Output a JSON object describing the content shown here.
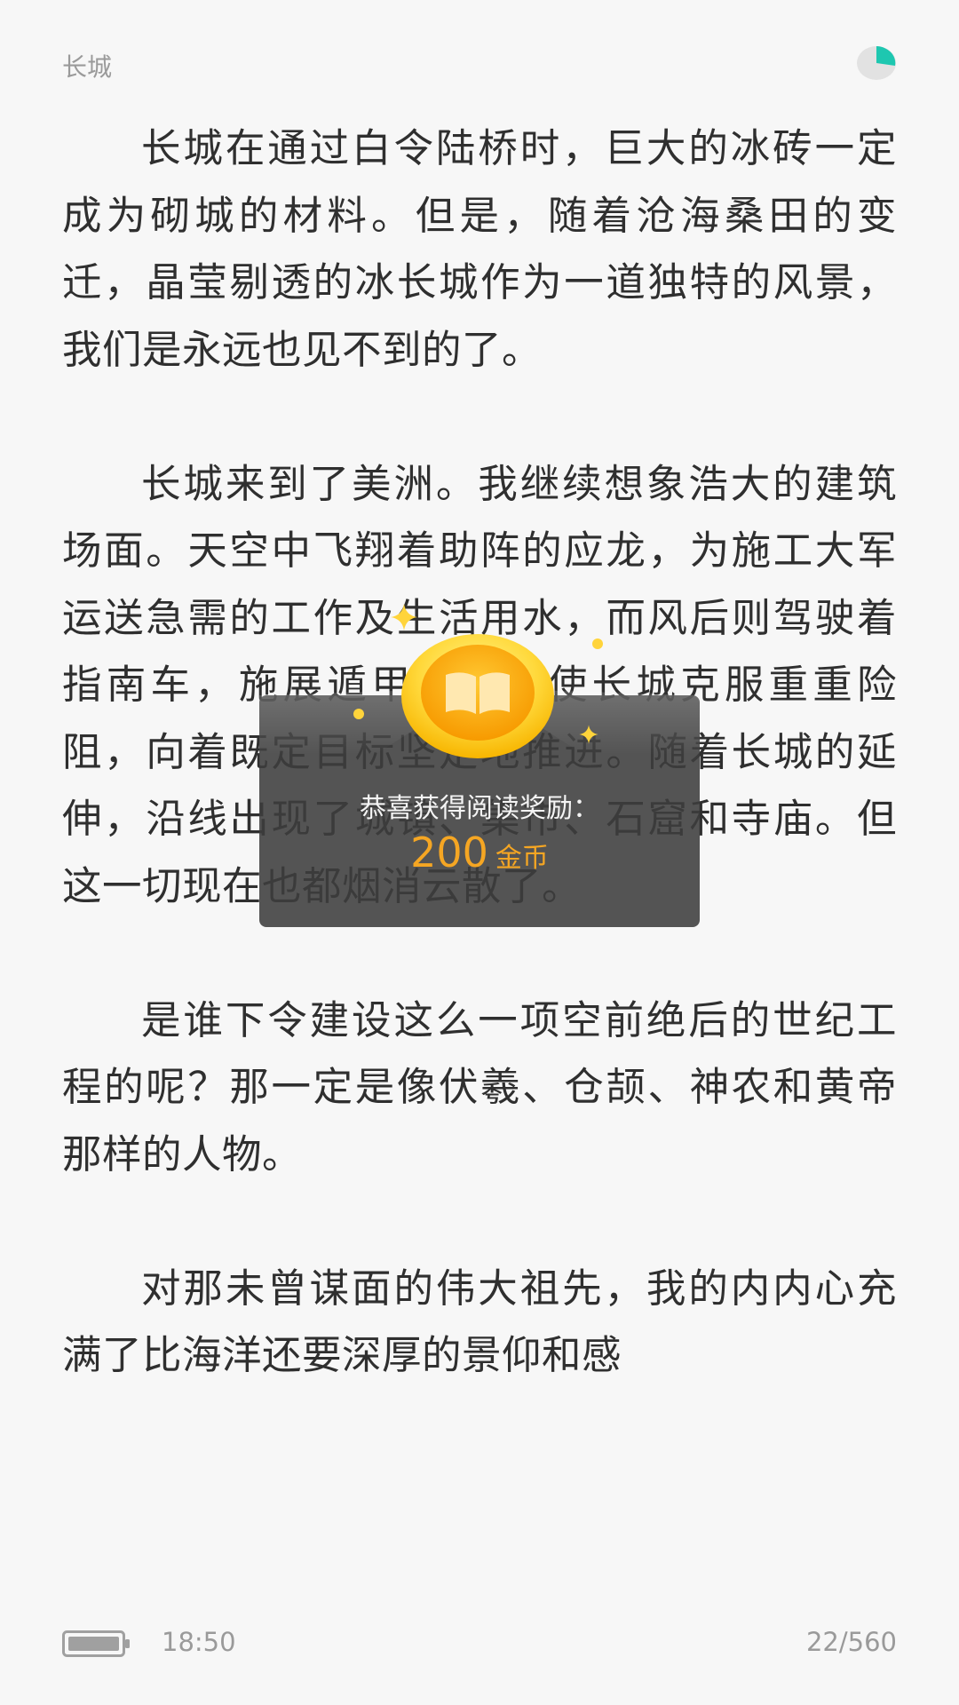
{
  "header": {
    "chapter_title": "长城",
    "progress_icon": "pie-progress-icon",
    "accent_color": "#1ec7b0"
  },
  "content": {
    "paragraphs": [
      "长城在通过白令陆桥时，巨大的冰砖一定成为砌城的材料。但是，随着沧海桑田的变迁，晶莹剔透的冰长城作为一道独特的风景，我们是永远也见不到的了。",
      "长城来到了美洲。我继续想象浩大的建筑场面。天空中飞翔着助阵的应龙，为施工大军运送急需的工作及生活用水，而风后则驾驶着指南车，施展遁甲大法，使长城克服重重险阻，向着既定目标坚定地推进。随着长城的延伸，沿线出现了城镇、集市、石窟和寺庙。但这一切现在也都烟消云散了。",
      "是谁下令建设这么一项空前绝后的世纪工程的呢？那一定是像伏羲、仓颉、神农和黄帝那样的人物。",
      "对那未曾谋面的伟大祖先，我的内内心充满了比海洋还要深厚的景仰和感"
    ]
  },
  "reward": {
    "message": "恭喜获得阅读奖励：",
    "amount": "200",
    "unit": "金币",
    "icon": "gold-coin-book-icon",
    "amount_color": "#f5a623"
  },
  "footer": {
    "time": "18:50",
    "page_indicator": "22/560",
    "battery_icon": "battery-icon"
  }
}
